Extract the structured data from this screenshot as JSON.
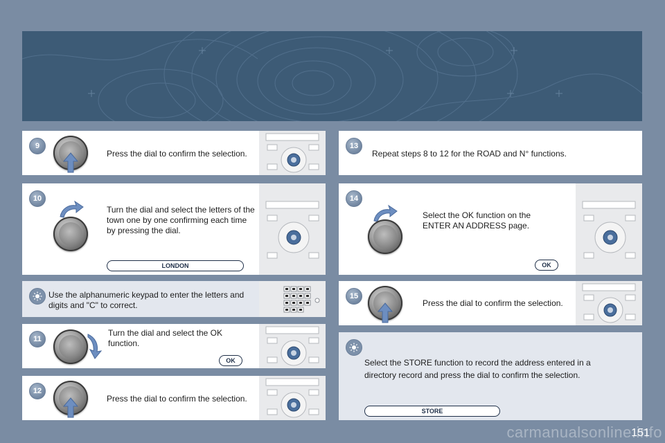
{
  "steps": {
    "s9": {
      "number": "9",
      "text": "Press the dial to confirm the selection."
    },
    "s10": {
      "number": "10",
      "text": "Turn the dial and select the letters of the town one by one confirming each time by pressing the dial.",
      "tag": "LONDON"
    },
    "tip1": {
      "text": "Use the alphanumeric keypad to enter the letters and digits and \"C\" to correct."
    },
    "s11": {
      "number": "11",
      "text": "Turn the dial and select the OK function.",
      "tag": "OK"
    },
    "s12": {
      "number": "12",
      "text": "Press the dial to confirm the selection."
    },
    "s13": {
      "number": "13",
      "text": "Repeat steps 8 to 12 for the ROAD and N° functions."
    },
    "s14": {
      "number": "14",
      "text": "Select the OK function on the ENTER AN ADDRESS page.",
      "tag": "OK"
    },
    "s15": {
      "number": "15",
      "text": "Press the dial to confirm the selection."
    },
    "tip2": {
      "text": "Select the STORE function to record the address entered in a directory record and press the dial to confirm the selection.",
      "tag": "STORE"
    }
  },
  "page_number": "151",
  "watermark": "carmanualsonline.info",
  "icons": {
    "tip": "lightbulb-icon",
    "dial": "control-dial-icon",
    "press": "arrow-up-icon",
    "turn": "curved-arrow-icon",
    "device": "radio-console-icon"
  },
  "colors": {
    "background": "#7a8ca3",
    "banner": "#3d5b76",
    "badge": "#7d91aa",
    "tag_border": "#1f2f48"
  }
}
